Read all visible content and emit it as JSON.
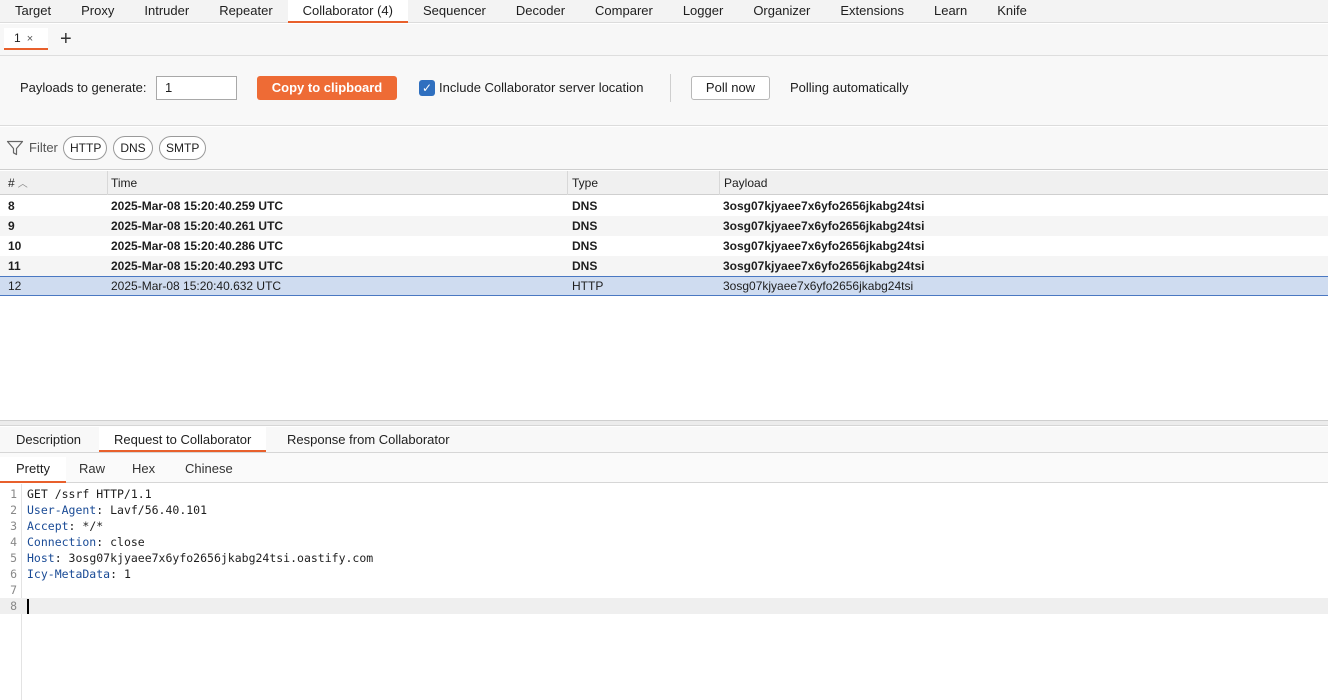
{
  "top_tabs": [
    "Target",
    "Proxy",
    "Intruder",
    "Repeater",
    "Collaborator (4)",
    "Sequencer",
    "Decoder",
    "Comparer",
    "Logger",
    "Organizer",
    "Extensions",
    "Learn",
    "Knife"
  ],
  "sub_tab": {
    "label": "1",
    "close": "×",
    "add": "+"
  },
  "toolbar": {
    "payloads_label": "Payloads to generate:",
    "payloads_value": "1",
    "copy_label": "Copy to clipboard",
    "include_label": "Include Collaborator server location",
    "include_checked": true,
    "poll_label": "Poll now",
    "poll_status": "Polling automatically"
  },
  "filter": {
    "label": "Filter",
    "chips": [
      "HTTP",
      "DNS",
      "SMTP"
    ]
  },
  "table": {
    "headers": [
      "#",
      "Time",
      "Type",
      "Payload"
    ],
    "rows": [
      {
        "num": "8",
        "time": "2025-Mar-08 15:20:40.259 UTC",
        "type": "DNS",
        "payload": "3osg07kjyaee7x6yfo2656jkabg24tsi"
      },
      {
        "num": "9",
        "time": "2025-Mar-08 15:20:40.261 UTC",
        "type": "DNS",
        "payload": "3osg07kjyaee7x6yfo2656jkabg24tsi"
      },
      {
        "num": "10",
        "time": "2025-Mar-08 15:20:40.286 UTC",
        "type": "DNS",
        "payload": "3osg07kjyaee7x6yfo2656jkabg24tsi"
      },
      {
        "num": "11",
        "time": "2025-Mar-08 15:20:40.293 UTC",
        "type": "DNS",
        "payload": "3osg07kjyaee7x6yfo2656jkabg24tsi"
      },
      {
        "num": "12",
        "time": "2025-Mar-08 15:20:40.632 UTC",
        "type": "HTTP",
        "payload": "3osg07kjyaee7x6yfo2656jkabg24tsi"
      }
    ]
  },
  "detail_tabs": [
    "Description",
    "Request to Collaborator",
    "Response from Collaborator"
  ],
  "view_tabs": [
    "Pretty",
    "Raw",
    "Hex",
    "Chinese"
  ],
  "request": {
    "lines": [
      {
        "num": "1",
        "key": "",
        "rest": "GET /ssrf HTTP/1.1"
      },
      {
        "num": "2",
        "key": "User-Agent",
        "rest": ": Lavf/56.40.101"
      },
      {
        "num": "3",
        "key": "Accept",
        "rest": ": */*"
      },
      {
        "num": "4",
        "key": "Connection",
        "rest": ": close"
      },
      {
        "num": "5",
        "key": "Host",
        "rest": ": 3osg07kjyaee7x6yfo2656jkabg24tsi.oastify.com"
      },
      {
        "num": "6",
        "key": "Icy-MetaData",
        "rest": ": 1"
      },
      {
        "num": "7",
        "key": "",
        "rest": ""
      },
      {
        "num": "8",
        "key": "",
        "rest": ""
      }
    ]
  },
  "colors": {
    "accent": "#e8602c",
    "button": "#ee6b35",
    "selection": "#cfdcf0",
    "header_key": "#1a4b96"
  }
}
